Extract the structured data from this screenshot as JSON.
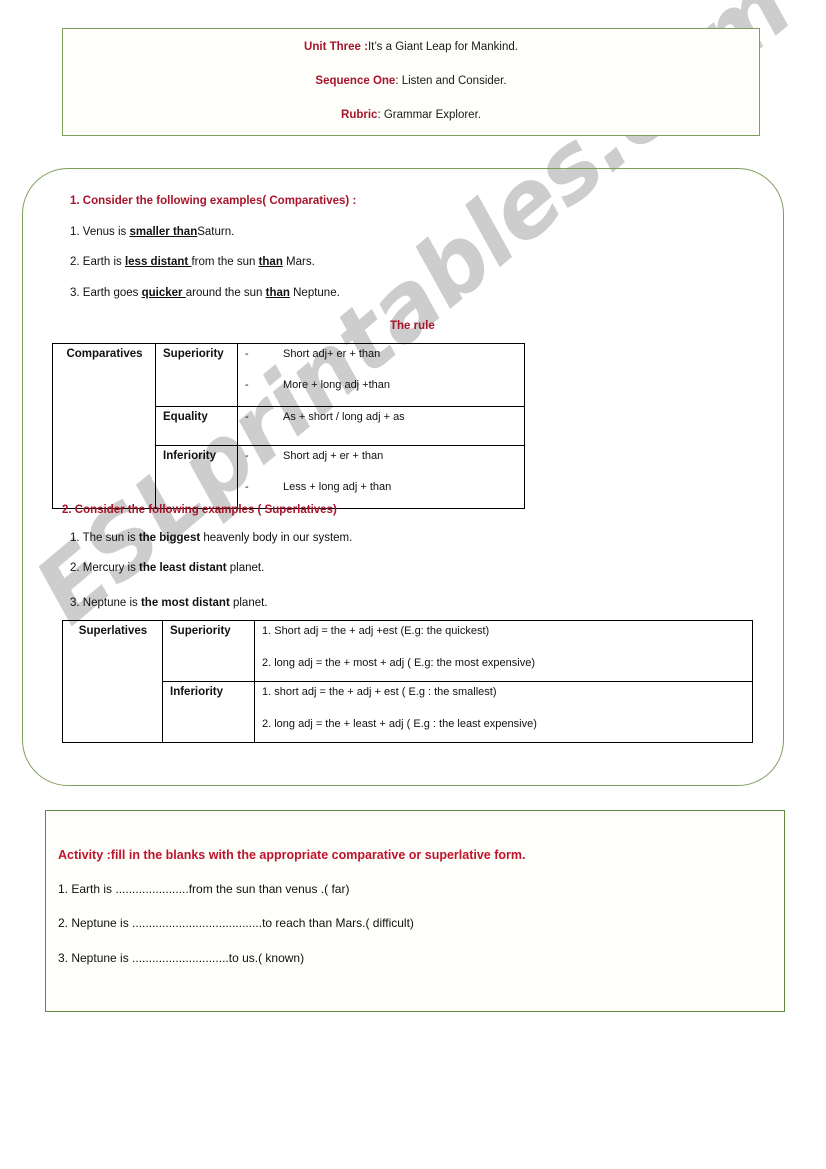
{
  "header": {
    "lines": [
      {
        "label": "Unit Three :",
        "text": "It’s a  Giant Leap for Mankind."
      },
      {
        "label": "Sequence One",
        "text": ": Listen and Consider."
      },
      {
        "label": "Rubric",
        "text": ": Grammar Explorer."
      }
    ]
  },
  "watermark": {
    "text": "ESLprintables.com"
  },
  "section_comparatives": {
    "heading": "1. Consider the following examples( Comparatives) :",
    "examples": [
      {
        "prefix": "1. Venus is ",
        "emphasis": "smaller than",
        "suffix": "Saturn."
      },
      {
        "prefix": "2. Earth is ",
        "emphasis": "less distant ",
        "mid": "from the sun ",
        "emphasis2": "than",
        "suffix": " Mars."
      },
      {
        "prefix": "3. Earth goes ",
        "emphasis": "quicker ",
        "mid": "around the sun ",
        "emphasis2": "than",
        "suffix": " Neptune."
      }
    ],
    "rule_title": "The rule",
    "table": {
      "row_label": "Comparatives",
      "rows": [
        {
          "type": "Superiority",
          "rules": [
            "Short adj+ er + than",
            "More + long adj +than"
          ]
        },
        {
          "type": "Equality",
          "rules": [
            "As + short / long adj + as"
          ]
        },
        {
          "type": "Inferiority",
          "rules": [
            "Short adj + er + than",
            "Less + long adj + than"
          ]
        }
      ]
    }
  },
  "section_superlatives": {
    "heading": "2. Consider the following examples ( Superlatives)",
    "examples": [
      {
        "prefix": "1. The sun is ",
        "emphasis": "the biggest",
        "suffix": " heavenly body in our system."
      },
      {
        "prefix": "2. Mercury is ",
        "emphasis": "the least distant",
        "suffix": " planet."
      },
      {
        "prefix": "3. Neptune is ",
        "emphasis": "the most distant",
        "suffix": " planet."
      }
    ],
    "table": {
      "row_label": "Superlatives",
      "rows": [
        {
          "type": "Superiority",
          "rules": [
            "1. Short adj  = the + adj +est (E.g: the quickest)",
            "2. long adj = the + most + adj ( E.g: the most expensive)"
          ]
        },
        {
          "type": "Inferiority",
          "rules": [
            "1. short adj = the + adj + est ( E.g : the smallest)",
            "2. long adj = the + least + adj ( E.g : the least expensive)"
          ]
        }
      ]
    }
  },
  "activity": {
    "title": "Activity :fill in the blanks with the appropriate comparative or superlative form.",
    "items": [
      "1. Earth is ......................from the sun than venus .( far)",
      "2. Neptune is .......................................to reach than Mars.( difficult)",
      "3. Neptune is .............................to us.( known)"
    ]
  },
  "colors": {
    "red": "#a8142a",
    "green_border": "#7e9e5c",
    "activity_border": "#5d8a3c",
    "watermark_gray": "#c9c9c9"
  }
}
